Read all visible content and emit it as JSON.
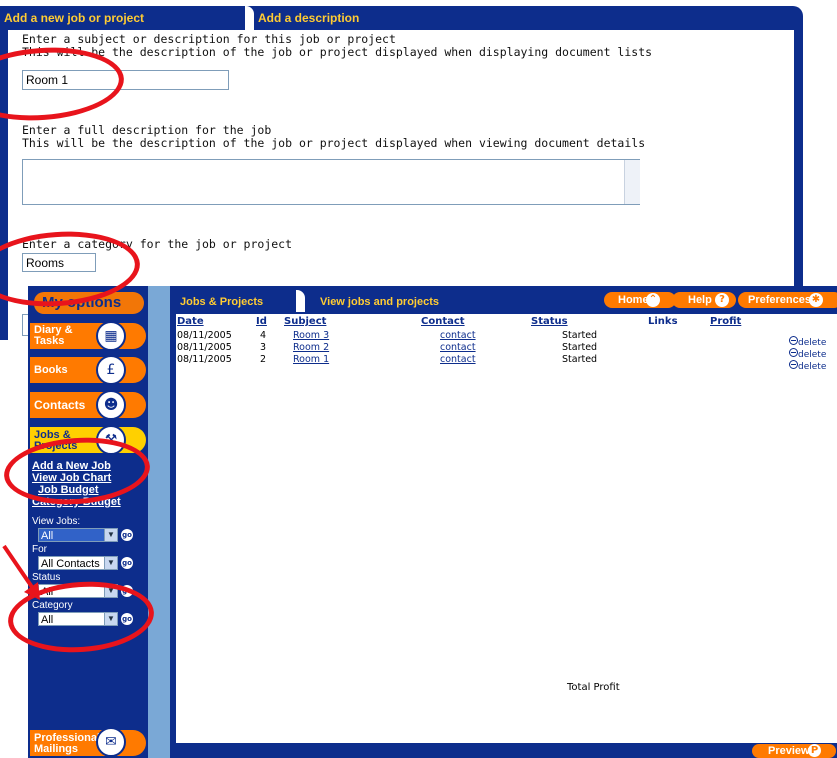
{
  "back_window": {
    "tabs": [
      "Add a new job or project",
      "Add a description"
    ],
    "subject_prompt_1": "Enter a subject or description for this job or project",
    "subject_prompt_2": "This will be the description of the job or project displayed when displaying document lists",
    "subject_value": "Room 1",
    "full_desc_prompt_1": "Enter a full description for the job",
    "full_desc_prompt_2": "This will be the description of the job or project displayed when viewing document details",
    "full_desc_value": "",
    "category_prompt": "Enter a category for the job or project",
    "category_value": "Rooms"
  },
  "front_window": {
    "sidebar": {
      "title": "My options",
      "menu": [
        {
          "label_line1": "Diary &",
          "label_line2": "Tasks",
          "icon": "calendar-icon"
        },
        {
          "label_line1": "Books",
          "label_line2": "",
          "icon": "pound-icon"
        },
        {
          "label_line1": "Contacts",
          "label_line2": "",
          "icon": "people-icon"
        },
        {
          "label_line1": "Jobs &",
          "label_line2": "Projects",
          "icon": "jobs-icon"
        }
      ],
      "links": [
        "Add a New Job",
        "View Job Chart",
        "Job Budget",
        "Category Budget"
      ],
      "filters": {
        "view_jobs_label": "View Jobs:",
        "view_jobs_value": "All",
        "for_label": "For",
        "for_value": "All Contacts",
        "status_label": "Status",
        "status_value": "All",
        "category_label": "Category",
        "category_value": "All"
      },
      "bottom_menu": {
        "label_line1": "Professional",
        "label_line2": "Mailings",
        "icon": "mail-icon"
      }
    },
    "tabs": [
      "Jobs & Projects",
      "View jobs and projects"
    ],
    "header_buttons": [
      {
        "label": "Home",
        "icon": "home-icon"
      },
      {
        "label": "Help",
        "icon": "help-icon"
      },
      {
        "label": "Preferences",
        "icon": "preferences-icon"
      }
    ],
    "table": {
      "headers": [
        "Date",
        "Id",
        "Subject",
        "Contact",
        "Status",
        "Links",
        "Profit"
      ],
      "rows": [
        {
          "date": "08/11/2005",
          "id": "4",
          "subject": "Room 3",
          "contact": "contact",
          "status": "Started",
          "action": "delete"
        },
        {
          "date": "08/11/2005",
          "id": "3",
          "subject": "Room 2",
          "contact": "contact",
          "status": "Started",
          "action": "delete"
        },
        {
          "date": "08/11/2005",
          "id": "2",
          "subject": "Room 1",
          "contact": "contact",
          "status": "Started",
          "action": "delete"
        }
      ]
    },
    "total_profit_label": "Total Profit",
    "preview_label": "Preview"
  },
  "colors": {
    "navy": "#0d2d8c",
    "orange": "#ff7a00",
    "tab_text": "#ffcc33",
    "annotation_red": "#e8141c",
    "strip": "#7aa8d6"
  }
}
